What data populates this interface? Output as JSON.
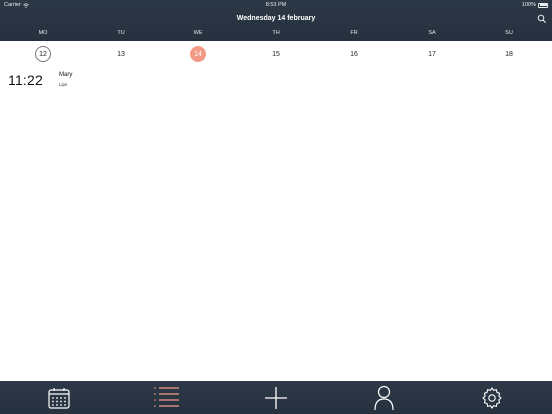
{
  "status_bar": {
    "carrier": "Carrier",
    "time": "8:53 PM",
    "battery": "100%"
  },
  "header": {
    "title": "Wednesday 14 february"
  },
  "week": {
    "day_names": [
      "MO",
      "TU",
      "WE",
      "TH",
      "FR",
      "SA",
      "SU"
    ],
    "dates": [
      "12",
      "13",
      "14",
      "15",
      "16",
      "17",
      "18"
    ],
    "today_index": 0,
    "selected_index": 2
  },
  "event": {
    "time": "11:22",
    "title": "Mary",
    "subtitle": "Lips"
  },
  "tabs": [
    "calendar-icon",
    "list-icon",
    "add-icon",
    "person-icon",
    "gear-icon"
  ],
  "colors": {
    "accent": "#f29a85",
    "bar": "#2a3544"
  }
}
